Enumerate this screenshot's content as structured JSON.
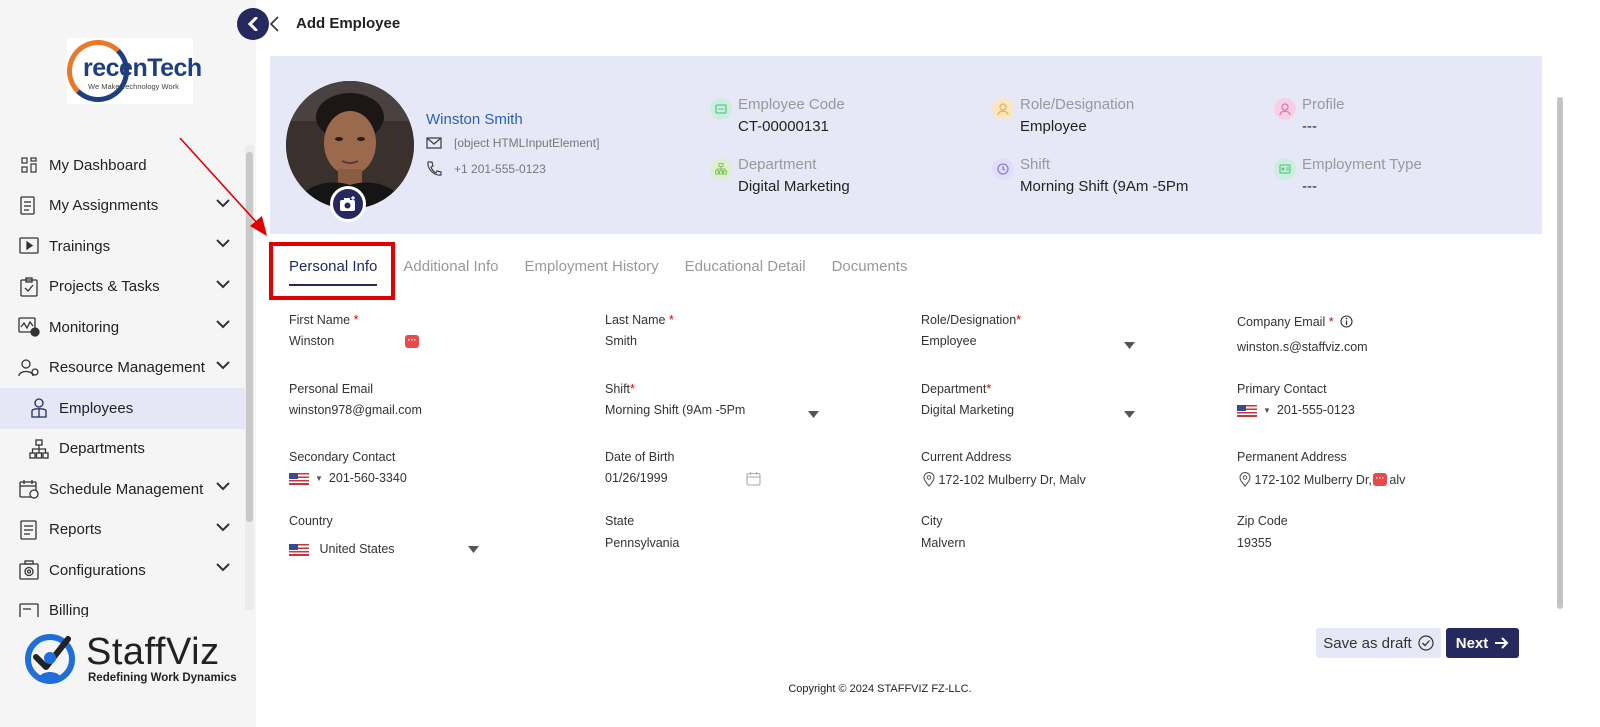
{
  "sidebar": {
    "logo_top": {
      "word": "recenTech",
      "tagline": "We Make Technology Work"
    },
    "items": [
      {
        "label": "My Dashboard",
        "icon": "dashboard-icon",
        "expandable": false
      },
      {
        "label": "My Assignments",
        "icon": "assignments-icon",
        "expandable": true
      },
      {
        "label": "Trainings",
        "icon": "trainings-icon",
        "expandable": true
      },
      {
        "label": "Projects & Tasks",
        "icon": "projects-icon",
        "expandable": true
      },
      {
        "label": "Monitoring",
        "icon": "monitoring-icon",
        "expandable": true
      },
      {
        "label": "Resource Management",
        "icon": "resource-icon",
        "expandable": true
      },
      {
        "label": "Employees",
        "icon": "employees-icon",
        "sub": true,
        "active": true
      },
      {
        "label": "Departments",
        "icon": "departments-icon",
        "sub": true
      },
      {
        "label": "Schedule Management",
        "icon": "schedule-icon",
        "expandable": true
      },
      {
        "label": "Reports",
        "icon": "reports-icon",
        "expandable": true
      },
      {
        "label": "Configurations",
        "icon": "configurations-icon",
        "expandable": true
      },
      {
        "label": "Billing",
        "icon": "billing-icon",
        "expandable": false
      }
    ],
    "logo_bottom": {
      "word": "StaffViz",
      "tagline": "Redefining Work Dynamics"
    }
  },
  "header": {
    "title": "Add Employee"
  },
  "profile": {
    "name": "Winston Smith",
    "email": "[object HTMLInputElement]",
    "phone": "+1 201-555-0123",
    "stats": [
      {
        "label": "Employee Code",
        "value": "CT-00000131",
        "color": "#58c98a"
      },
      {
        "label": "Role/Designation",
        "value": "Employee",
        "color": "#f0b24a"
      },
      {
        "label": "Profile",
        "value": "---",
        "color": "#e874b4"
      },
      {
        "label": "Department",
        "value": "Digital Marketing",
        "color": "#7fc25e"
      },
      {
        "label": "Shift",
        "value": "Morning Shift (9Am -5Pm",
        "color": "#8b7fe0"
      },
      {
        "label": "Employment Type",
        "value": "---",
        "color": "#58c98a"
      }
    ]
  },
  "tabs": [
    "Personal Info",
    "Additional Info",
    "Employment History",
    "Educational Detail",
    "Documents"
  ],
  "active_tab": "Personal Info",
  "form": {
    "first_name": {
      "label": "First Name",
      "value": "Winston"
    },
    "last_name": {
      "label": "Last Name",
      "value": "Smith"
    },
    "role": {
      "label": "Role/Designation",
      "value": "Employee"
    },
    "company_email": {
      "label": "Company Email",
      "value": "winston.s@staffviz.com"
    },
    "personal_email": {
      "label": "Personal Email",
      "value": "winston978@gmail.com"
    },
    "shift": {
      "label": "Shift",
      "value": "Morning Shift (9Am -5Pm"
    },
    "department": {
      "label": "Department",
      "value": "Digital Marketing"
    },
    "primary_contact": {
      "label": "Primary Contact",
      "value": "201-555-0123"
    },
    "secondary_contact": {
      "label": "Secondary Contact",
      "value": "201-560-3340"
    },
    "dob": {
      "label": "Date of Birth",
      "value": "01/26/1999"
    },
    "current_address": {
      "label": "Current Address",
      "value": "172-102 Mulberry Dr, Malv"
    },
    "permanent_address": {
      "label": "Permanent Address",
      "value": "172-102 Mulberry Dr, ",
      "value_tail": "alv"
    },
    "country": {
      "label": "Country",
      "value": "United States"
    },
    "state": {
      "label": "State",
      "value": "Pennsylvania"
    },
    "city": {
      "label": "City",
      "value": "Malvern"
    },
    "zip": {
      "label": "Zip Code",
      "value": "19355"
    }
  },
  "actions": {
    "draft": "Save as draft",
    "next": "Next"
  },
  "footer": {
    "copyright": "Copyright © 2024 STAFFVIZ FZ-LLC."
  },
  "colors": {
    "primary": "#26295e",
    "banner": "#e6e8f8",
    "required": "#e00000",
    "link": "#2d5fb5"
  }
}
